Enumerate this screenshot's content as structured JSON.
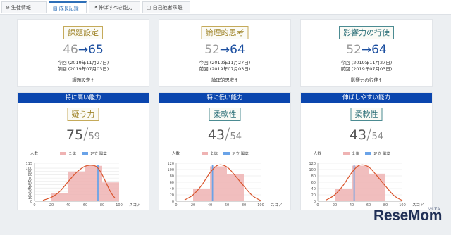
{
  "tabs": [
    {
      "icon": "user-circle-icon",
      "glyph": "⊖",
      "label": "生徒情報",
      "active": false
    },
    {
      "icon": "chart-icon",
      "glyph": "▨",
      "label": "成長記録",
      "active": true
    },
    {
      "icon": "trend-icon",
      "glyph": "↗",
      "label": "伸ばすべき能力",
      "active": false
    },
    {
      "icon": "document-icon",
      "glyph": "▢",
      "label": "自己他者乖離",
      "active": false
    }
  ],
  "top_cards": [
    {
      "title": "課題設定",
      "prev": "46",
      "arrow": "→",
      "curr": "65",
      "date_now": "今回 (2019年11月27日)",
      "date_prev": "前回 (2019年07月03日)",
      "caption": "課題設定↑",
      "style": "gold"
    },
    {
      "title": "論理的思考",
      "prev": "52",
      "arrow": "→",
      "curr": "64",
      "date_now": "今回 (2019年11月27日)",
      "date_prev": "前回 (2019年07月03日)",
      "caption": "論理的思考↑",
      "style": "gold"
    },
    {
      "title": "影響力の行使",
      "prev": "52",
      "arrow": "→",
      "curr": "64",
      "date_now": "今回 (2019年11月27日)",
      "date_prev": "前回 (2019年07月03日)",
      "caption": "影響力の行使↑",
      "style": "teal"
    }
  ],
  "bottom_cards": [
    {
      "header": "特に高い能力",
      "title": "疑う力",
      "score": "75",
      "slash": "/",
      "mean": "59",
      "style": "gold"
    },
    {
      "header": "特に低い能力",
      "title": "柔軟性",
      "score": "43",
      "slash": "/",
      "mean": "54",
      "style": "teal"
    },
    {
      "header": "伸ばしやすい能力",
      "title": "柔軟性",
      "score": "43",
      "slash": "/",
      "mean": "54",
      "style": "teal"
    }
  ],
  "colors": {
    "bar": "#0b46ae",
    "hist": "#efb3b3",
    "curve": "#d9532a",
    "marker": "#6aa3e8"
  },
  "chart_data": [
    {
      "type": "bar",
      "ylabel": "人数",
      "xlabel": "スコア",
      "legend": [
        "全体",
        "足立 陽菜"
      ],
      "categories": [
        "20-40",
        "40-60",
        "60-80",
        "80-100"
      ],
      "values": [
        25,
        90,
        107,
        57
      ],
      "yticks": [
        "0",
        "10",
        "20",
        "30",
        "40",
        "50",
        "60",
        "70",
        "80",
        "90",
        "100",
        "115"
      ],
      "ylim": [
        0,
        115
      ],
      "xticks": [
        "0",
        "20",
        "40",
        "60",
        "80",
        "100"
      ],
      "xlim": [
        0,
        100
      ],
      "marker": 75,
      "curve": [
        [
          10,
          3
        ],
        [
          20,
          12
        ],
        [
          30,
          30
        ],
        [
          40,
          60
        ],
        [
          50,
          88
        ],
        [
          60,
          106
        ],
        [
          70,
          108
        ],
        [
          75,
          100
        ],
        [
          80,
          80
        ],
        [
          90,
          28
        ],
        [
          95,
          10
        ]
      ]
    },
    {
      "type": "bar",
      "ylabel": "人数",
      "xlabel": "スコア",
      "legend": [
        "全体",
        "足立 陽菜"
      ],
      "categories": [
        "20-40",
        "40-60",
        "60-80"
      ],
      "values": [
        38,
        110,
        85
      ],
      "yticks": [
        "0",
        "20",
        "40",
        "60",
        "80",
        "100",
        "120"
      ],
      "ylim": [
        0,
        120
      ],
      "xticks": [
        "0",
        "20",
        "40",
        "60",
        "80",
        "100"
      ],
      "xlim": [
        0,
        100
      ],
      "marker": 43,
      "curve": [
        [
          10,
          4
        ],
        [
          20,
          20
        ],
        [
          30,
          50
        ],
        [
          40,
          90
        ],
        [
          48,
          112
        ],
        [
          55,
          114
        ],
        [
          62,
          104
        ],
        [
          70,
          80
        ],
        [
          80,
          48
        ],
        [
          90,
          18
        ],
        [
          100,
          2
        ]
      ]
    },
    {
      "type": "bar",
      "ylabel": "人数",
      "xlabel": "スコア",
      "legend": [
        "全体",
        "足立 陽菜"
      ],
      "categories": [
        "20-40",
        "40-60",
        "60-80"
      ],
      "values": [
        38,
        112,
        87
      ],
      "yticks": [
        "0",
        "20",
        "40",
        "60",
        "80",
        "100",
        "120"
      ],
      "ylim": [
        0,
        120
      ],
      "xticks": [
        "0",
        "20",
        "40",
        "60",
        "80",
        "100"
      ],
      "xlim": [
        0,
        100
      ],
      "marker": 43,
      "curve": [
        [
          10,
          4
        ],
        [
          20,
          20
        ],
        [
          30,
          50
        ],
        [
          40,
          90
        ],
        [
          48,
          112
        ],
        [
          55,
          114
        ],
        [
          62,
          104
        ],
        [
          70,
          80
        ],
        [
          80,
          48
        ],
        [
          90,
          18
        ],
        [
          100,
          2
        ]
      ]
    }
  ],
  "watermark": {
    "brand": "ReseMom",
    "sub": "リセマム"
  }
}
